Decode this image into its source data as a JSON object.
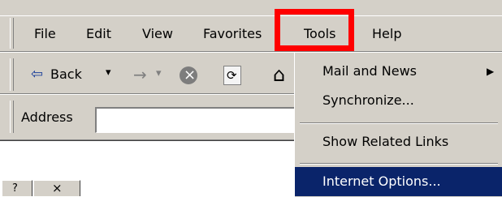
{
  "menubar": {
    "items": [
      {
        "id": "file",
        "label": "File"
      },
      {
        "id": "edit",
        "label": "Edit"
      },
      {
        "id": "view",
        "label": "View"
      },
      {
        "id": "favorites",
        "label": "Favorites"
      },
      {
        "id": "tools",
        "label": "Tools"
      },
      {
        "id": "help",
        "label": "Help"
      }
    ]
  },
  "toolbar": {
    "back_label": "Back",
    "back_arrow_glyph": "⇦",
    "forward_arrow_glyph": "→",
    "dropdown_glyph": "▾",
    "stop_glyph": "×",
    "refresh_glyph": "⟳",
    "home_glyph": "⌂"
  },
  "address": {
    "label": "Address",
    "value": ""
  },
  "tools_menu": {
    "items": [
      {
        "label": "Mail and News",
        "submenu_glyph": "▶"
      },
      {
        "label": "Synchronize..."
      },
      {
        "label": "Show Related Links"
      },
      {
        "label": "Internet Options...",
        "selected": true
      }
    ]
  },
  "window_corner": {
    "help_glyph": "?",
    "close_glyph": "×"
  },
  "colors": {
    "chrome_bg": "#d4d0c8",
    "selection_bg": "#0a246a",
    "highlight_border": "#ff0000",
    "disabled_icon": "#808080",
    "icon_blue": "#1c3f9a"
  }
}
